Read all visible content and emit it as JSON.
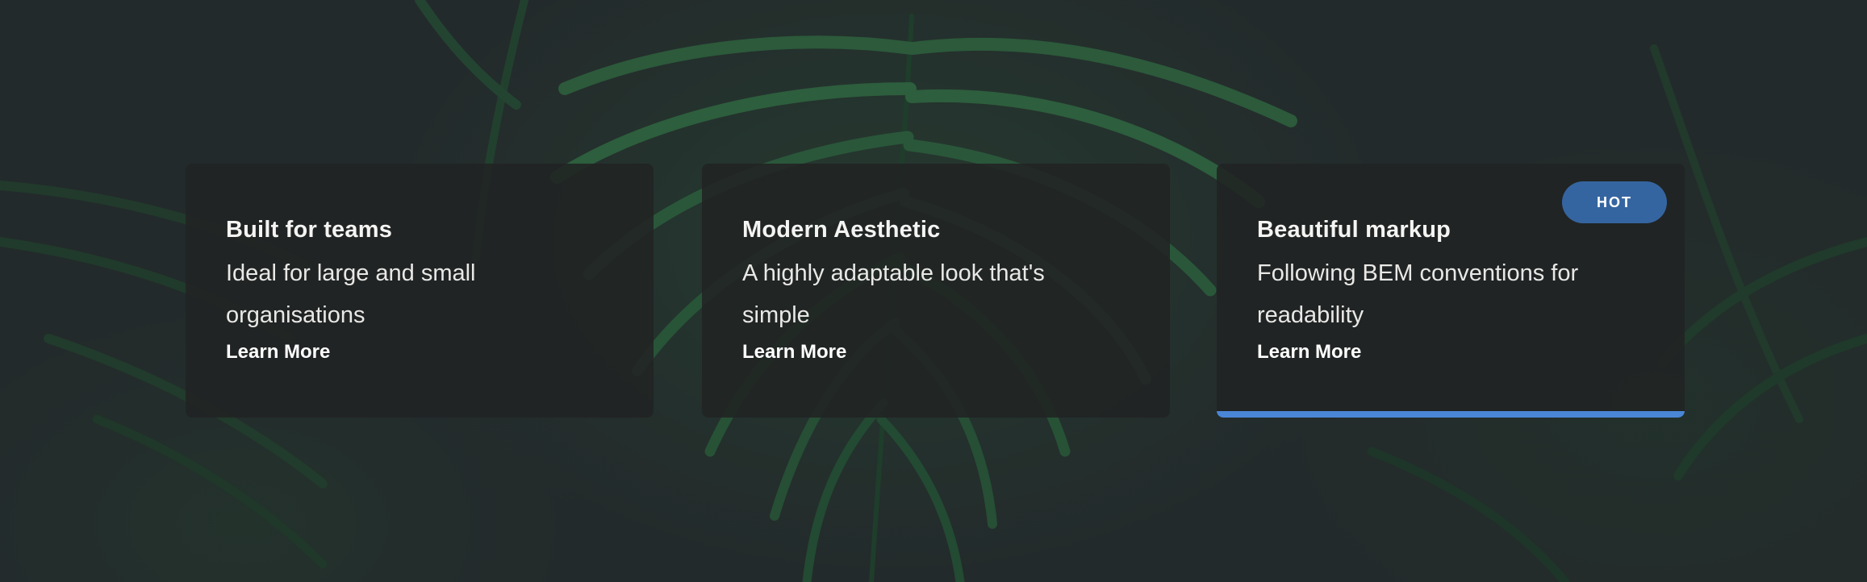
{
  "cards": [
    {
      "title": "Built for teams",
      "description": "Ideal for large and small organisations",
      "link_label": "Learn More"
    },
    {
      "title": "Modern Aesthetic",
      "description": "A highly adaptable look that's simple",
      "link_label": "Learn More"
    },
    {
      "title": "Beautiful markup",
      "description": "Following BEM conventions for readability",
      "link_label": "Learn More",
      "badge": "HOT"
    }
  ],
  "colors": {
    "background": "#242a2b",
    "card_background": "#212323",
    "badge_background": "#3565a0",
    "accent_bar": "#4a86d6",
    "text": "#f4f4f2"
  },
  "background_image": "dark-fern-leaves"
}
